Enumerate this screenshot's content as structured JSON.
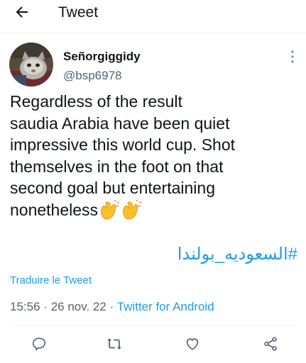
{
  "header": {
    "back_icon": "arrow-left-icon",
    "title": "Tweet"
  },
  "author": {
    "display_name": "Señorgiggidy",
    "handle": "@bsp6978",
    "avatar_icon": "cat-avatar"
  },
  "tweet": {
    "lines": [
      "Regardless of the result",
      "saudia Arabia have been quiet",
      "impressive this world cup. Shot",
      "themselves in the foot on that",
      "second goal but entertaining",
      "nonetheless"
    ],
    "emoji": "👏👏",
    "hashtag": "#السعوديه_بولندا"
  },
  "translate_label": "Traduire le Tweet",
  "meta": {
    "time": "15:56",
    "separator": "·",
    "date": "26 nov. 22",
    "source": "Twitter for Android"
  },
  "actions": {
    "reply_icon": "reply-icon",
    "retweet_icon": "retweet-icon",
    "like_icon": "like-icon",
    "share_icon": "share-icon"
  },
  "colors": {
    "accent": "#1d9bf0",
    "text_primary": "#0f1419",
    "text_secondary": "#536471",
    "divider": "#eff3f4"
  }
}
